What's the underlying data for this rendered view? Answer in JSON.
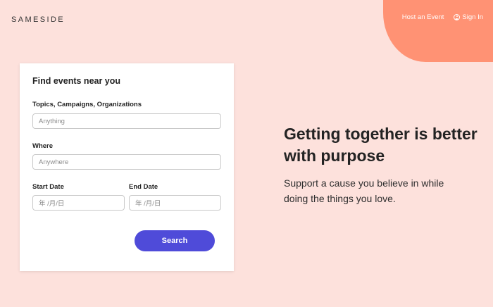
{
  "header": {
    "logo": "SAMESIDE",
    "nav": {
      "host_event": "Host an Event",
      "sign_in": "Sign In"
    }
  },
  "search_card": {
    "title": "Find events near you",
    "topics_label": "Topics, Campaigns, Organizations",
    "topics_placeholder": "Anything",
    "where_label": "Where",
    "where_placeholder": "Anywhere",
    "start_date_label": "Start Date",
    "start_date_placeholder": "年 /月/日",
    "end_date_label": "End Date",
    "end_date_placeholder": "年 /月/日",
    "search_button": "Search"
  },
  "hero": {
    "title": "Getting together is better with purpose",
    "subtitle": "Support a cause you believe in while doing the things you love."
  },
  "colors": {
    "background": "#fde1dc",
    "accent_blob": "#ff9274",
    "button": "#4f4bd9"
  },
  "icons": {
    "sign_in": "user-circle-icon"
  }
}
